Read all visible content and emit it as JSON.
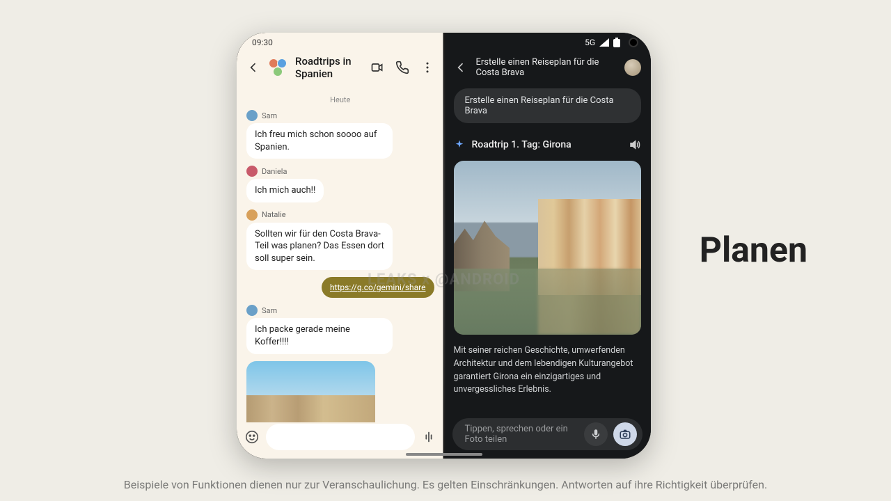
{
  "left": {
    "status_time": "09:30",
    "chat_title": "Roadtrips in Spanien",
    "day_label": "Heute",
    "messages": [
      {
        "sender": "Sam",
        "text": "Ich freu mich schon soooo auf Spanien.",
        "avatar": "#6aa0c8"
      },
      {
        "sender": "Daniela",
        "text": "Ich mich auch!!",
        "avatar": "#c85a6a"
      },
      {
        "sender": "Natalie",
        "text": "Sollten wir für den Costa Brava-Teil was planen? Das Essen dort soll super sein.",
        "avatar": "#d8a05a"
      }
    ],
    "outgoing_link": "https://g.co/gemini/share",
    "sam2": {
      "sender": "Sam",
      "text": "Ich packe gerade meine Koffer!!!!",
      "avatar": "#6aa0c8"
    }
  },
  "right": {
    "status_network": "5G",
    "header_title": "Erstelle einen Reiseplan für die Costa Brava",
    "prompt_text": "Erstelle einen Reiseplan für die Costa Brava",
    "result_title": "Roadtrip 1. Tag: Girona",
    "result_desc": "Mit seiner reichen Geschichte, umwerfenden Architektur und dem lebendigen Kulturangebot garantiert Girona ein einzigartiges und unvergessliches Erlebnis.",
    "input_placeholder": "Tippen, sprechen oder ein Foto teilen"
  },
  "big_word": "Planen",
  "disclaimer": "Beispiele von Funktionen dienen nur zur Veranschaulichung. Es gelten Einschränkungen. Antworten auf ihre Richtigkeit überprüfen.",
  "watermark": "LEAKS x @ANDROID"
}
